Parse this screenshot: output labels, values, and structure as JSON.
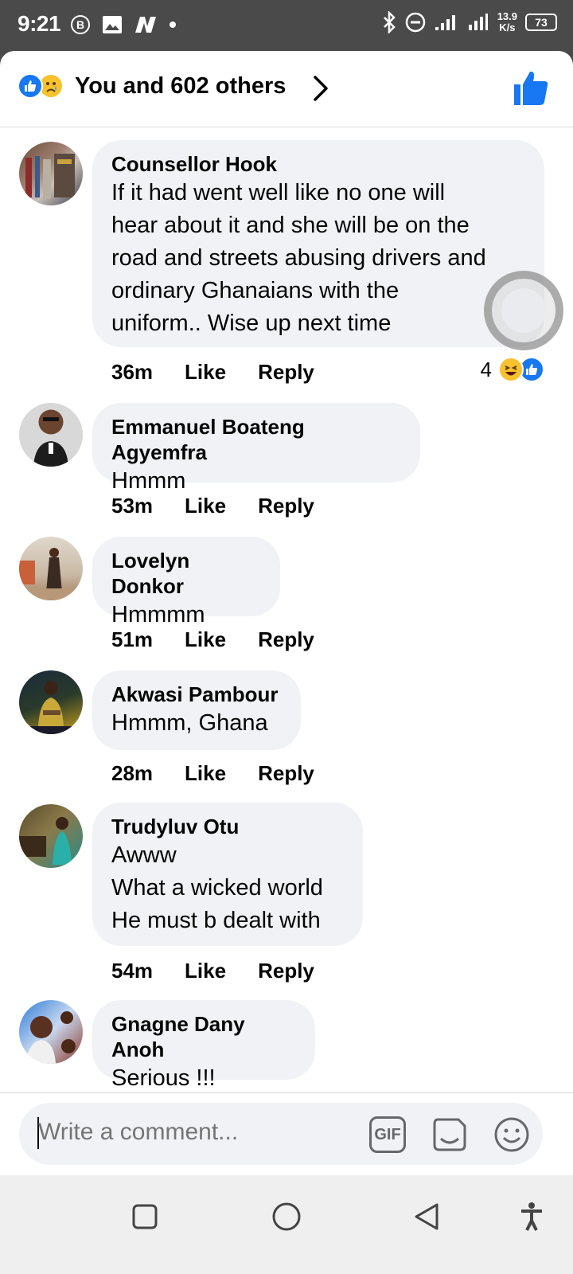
{
  "status_bar": {
    "time": "9:21",
    "network_speed_value": "13.9",
    "network_speed_unit": "K/s",
    "battery": "73"
  },
  "reactions_header": {
    "summary": "You and 602 others",
    "icons": [
      "like-reaction-icon",
      "sad-reaction-icon",
      "chevron-right-icon",
      "thumbs-up-icon"
    ]
  },
  "comments": [
    {
      "author": "Counsellor Hook",
      "text": "If it had went well like no one will\nhear about it and she will be on the\nroad and streets abusing drivers and\nordinary Ghanaians with the\nuniform.. Wise up next time",
      "time": "36m",
      "like_label": "Like",
      "reply_label": "Reply",
      "reaction_count": "4"
    },
    {
      "author": "Emmanuel Boateng Agyemfra",
      "text": "Hmmm",
      "time": "53m",
      "like_label": "Like",
      "reply_label": "Reply"
    },
    {
      "author": "Lovelyn Donkor",
      "text": "Hmmmm",
      "time": "51m",
      "like_label": "Like",
      "reply_label": "Reply"
    },
    {
      "author": "Akwasi Pambour",
      "text": "Hmmm, Ghana",
      "time": "28m",
      "like_label": "Like",
      "reply_label": "Reply"
    },
    {
      "author": "Trudyluv Otu",
      "text": "Awww\nWhat a wicked world\nHe must b dealt with",
      "time": "54m",
      "like_label": "Like",
      "reply_label": "Reply"
    },
    {
      "author": "Gnagne Dany Anoh",
      "text": "Serious !!!"
    }
  ],
  "composer": {
    "placeholder": "Write a comment...",
    "gif_label": "GIF",
    "icons": [
      "gif-icon",
      "sticker-icon",
      "emoji-icon"
    ]
  },
  "nav_bar": {
    "icons": [
      "recents-icon",
      "home-icon",
      "back-icon",
      "accessibility-icon"
    ]
  },
  "colors": {
    "accent": "#1877f2",
    "bubble": "#f0f2f5",
    "status_bar": "#4a4a4a",
    "nav_bar": "#efefef"
  }
}
